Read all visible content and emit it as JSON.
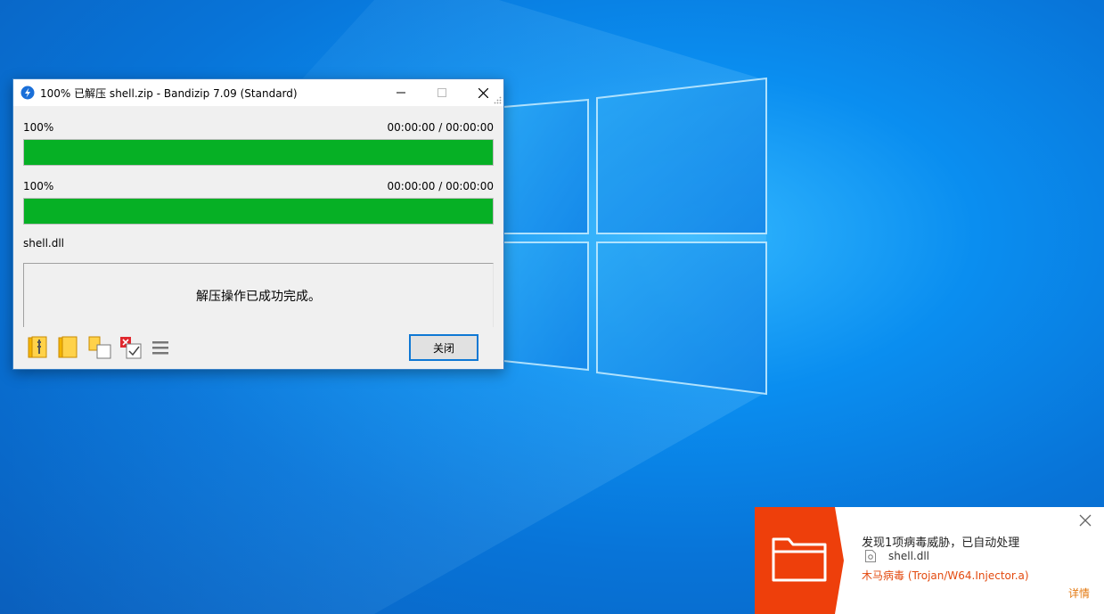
{
  "window": {
    "title": "100% 已解压 shell.zip - Bandizip 7.09 (Standard)",
    "minimize_icon": "minimize-icon",
    "maximize_icon": "maximize-icon",
    "close_icon": "close-icon"
  },
  "progress": [
    {
      "label": "100%",
      "time": "00:00:00 / 00:00:00",
      "value": 1.0
    },
    {
      "label": "100%",
      "time": "00:00:00 / 00:00:00",
      "value": 1.0
    }
  ],
  "current_file": "shell.dll",
  "status_message": "解压操作已成功完成。",
  "toolbar": {
    "icons": [
      "open-folder-archive-icon",
      "open-folder-icon",
      "copy-files-icon",
      "delete-archive-check-icon",
      "menu-icon"
    ],
    "close_label": "关闭"
  },
  "colors": {
    "progress_fill": "#06b025",
    "toast_accent": "#ee3f0b",
    "threat_text": "#e34a0f",
    "window_border": "#3a82c8"
  },
  "toast": {
    "title": "发现1项病毒威胁，已自动处理",
    "file": "shell.dll",
    "threat": "木马病毒 (Trojan/W64.Injector.a)",
    "details_label": "详情",
    "icon": "folder-icon"
  }
}
